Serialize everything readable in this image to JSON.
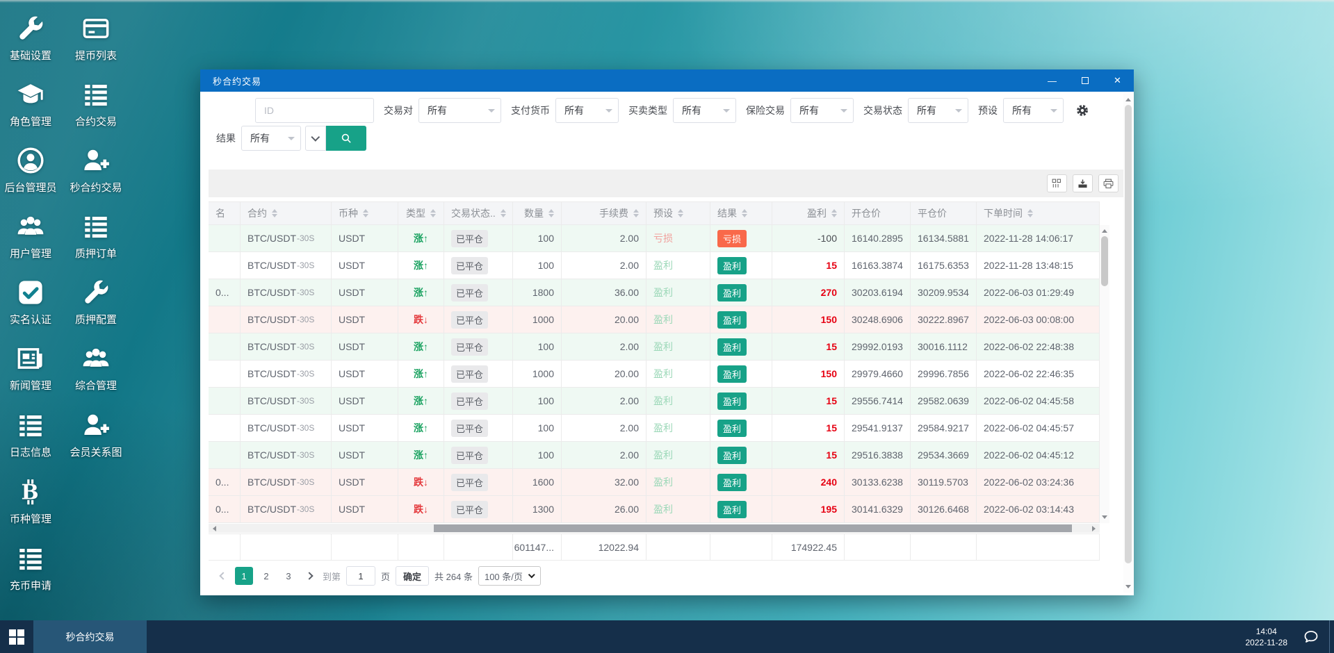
{
  "colors": {
    "titlebar_blue": "#0a6dc2",
    "accent_teal": "#17a288",
    "rise_green": "#1aa260",
    "fall_red": "#e4393c",
    "profit_red": "#e60012",
    "loss_chip_orange": "#f9694a",
    "row_green_tint": "#eff9f3",
    "row_fall_tint": "#fdf1ef",
    "taskbar_navy": "#152f4a"
  },
  "desktop": {
    "icons": [
      {
        "label": "基础设置",
        "icon": "wrench-icon"
      },
      {
        "label": "提币列表",
        "icon": "card-icon"
      },
      {
        "label": "角色管理",
        "icon": "graduation-cap-icon"
      },
      {
        "label": "合约交易",
        "icon": "list-icon"
      },
      {
        "label": "后台管理员",
        "icon": "user-circle-icon"
      },
      {
        "label": "秒合约交易",
        "icon": "user-plus-icon"
      },
      {
        "label": "用户管理",
        "icon": "users-icon"
      },
      {
        "label": "质押订单",
        "icon": "list-icon"
      },
      {
        "label": "实名认证",
        "icon": "check-square-icon"
      },
      {
        "label": "质押配置",
        "icon": "wrench-icon"
      },
      {
        "label": "新闻管理",
        "icon": "newspaper-icon"
      },
      {
        "label": "综合管理",
        "icon": "users-icon"
      },
      {
        "label": "日志信息",
        "icon": "list-icon"
      },
      {
        "label": "会员关系图",
        "icon": "user-plus-icon"
      },
      {
        "label": "币种管理",
        "icon": "bitcoin-icon"
      },
      {
        "label": "充币申请",
        "icon": "list-icon"
      }
    ]
  },
  "window": {
    "title": "秒合约交易",
    "controls": {
      "minimize": "—",
      "close": "✕"
    },
    "filters": {
      "id_placeholder": "ID",
      "selects": [
        {
          "label": "交易对",
          "value": "所有"
        },
        {
          "label": "支付货币",
          "value": "所有"
        },
        {
          "label": "买卖类型",
          "value": "所有"
        },
        {
          "label": "保险交易",
          "value": "所有"
        },
        {
          "label": "交易状态",
          "value": "所有"
        },
        {
          "label": "预设",
          "value": "所有"
        }
      ],
      "result_label": "结果",
      "result_value": "所有"
    },
    "toolbar": {
      "buttons": [
        "columns-icon",
        "export-icon",
        "printer-icon"
      ]
    },
    "table": {
      "columns": [
        {
          "key": "user",
          "label": "名",
          "sortable": false,
          "align": "left"
        },
        {
          "key": "contract",
          "label": "合约",
          "sortable": true,
          "align": "left"
        },
        {
          "key": "coin",
          "label": "币种",
          "sortable": true,
          "align": "left"
        },
        {
          "key": "type",
          "label": "类型",
          "sortable": true,
          "align": "center"
        },
        {
          "key": "status",
          "label": "交易状态..",
          "sortable": true,
          "align": "left"
        },
        {
          "key": "qty",
          "label": "数量",
          "sortable": true,
          "align": "right"
        },
        {
          "key": "fee",
          "label": "手续费",
          "sortable": true,
          "align": "right"
        },
        {
          "key": "preset",
          "label": "预设",
          "sortable": true,
          "align": "left"
        },
        {
          "key": "result",
          "label": "结果",
          "sortable": true,
          "align": "left"
        },
        {
          "key": "profit",
          "label": "盈利",
          "sortable": true,
          "align": "right"
        },
        {
          "key": "open",
          "label": "开仓价",
          "sortable": false,
          "align": "left"
        },
        {
          "key": "close",
          "label": "平仓价",
          "sortable": false,
          "align": "left"
        },
        {
          "key": "time",
          "label": "下单时间",
          "sortable": true,
          "align": "left"
        }
      ],
      "rows": [
        {
          "user": "",
          "contract": "BTC/USDT",
          "suffix": "-30S",
          "coin": "USDT",
          "type": "涨",
          "status": "已平仓",
          "qty": "100",
          "fee": "2.00",
          "preset": "亏损",
          "result": "亏损",
          "profit": "-100",
          "open": "16140.2895",
          "close": "16134.5881",
          "time": "2022-11-28 14:06:17"
        },
        {
          "user": "",
          "contract": "BTC/USDT",
          "suffix": "-30S",
          "coin": "USDT",
          "type": "涨",
          "status": "已平仓",
          "qty": "100",
          "fee": "2.00",
          "preset": "盈利",
          "result": "盈利",
          "profit": "15",
          "open": "16163.3874",
          "close": "16175.6353",
          "time": "2022-11-28 13:48:15"
        },
        {
          "user": "0...",
          "contract": "BTC/USDT",
          "suffix": "-30S",
          "coin": "USDT",
          "type": "涨",
          "status": "已平仓",
          "qty": "1800",
          "fee": "36.00",
          "preset": "盈利",
          "result": "盈利",
          "profit": "270",
          "open": "30203.6194",
          "close": "30209.9534",
          "time": "2022-06-03 01:29:49"
        },
        {
          "user": "",
          "contract": "BTC/USDT",
          "suffix": "-30S",
          "coin": "USDT",
          "type": "跌",
          "status": "已平仓",
          "qty": "1000",
          "fee": "20.00",
          "preset": "盈利",
          "result": "盈利",
          "profit": "150",
          "open": "30248.6906",
          "close": "30222.8967",
          "time": "2022-06-03 00:08:00"
        },
        {
          "user": "",
          "contract": "BTC/USDT",
          "suffix": "-30S",
          "coin": "USDT",
          "type": "涨",
          "status": "已平仓",
          "qty": "100",
          "fee": "2.00",
          "preset": "盈利",
          "result": "盈利",
          "profit": "15",
          "open": "29992.0193",
          "close": "30016.1112",
          "time": "2022-06-02 22:48:38"
        },
        {
          "user": "",
          "contract": "BTC/USDT",
          "suffix": "-30S",
          "coin": "USDT",
          "type": "涨",
          "status": "已平仓",
          "qty": "1000",
          "fee": "20.00",
          "preset": "盈利",
          "result": "盈利",
          "profit": "150",
          "open": "29979.4660",
          "close": "29996.7856",
          "time": "2022-06-02 22:46:35"
        },
        {
          "user": "",
          "contract": "BTC/USDT",
          "suffix": "-30S",
          "coin": "USDT",
          "type": "涨",
          "status": "已平仓",
          "qty": "100",
          "fee": "2.00",
          "preset": "盈利",
          "result": "盈利",
          "profit": "15",
          "open": "29556.7414",
          "close": "29582.0639",
          "time": "2022-06-02 04:45:58"
        },
        {
          "user": "",
          "contract": "BTC/USDT",
          "suffix": "-30S",
          "coin": "USDT",
          "type": "涨",
          "status": "已平仓",
          "qty": "100",
          "fee": "2.00",
          "preset": "盈利",
          "result": "盈利",
          "profit": "15",
          "open": "29541.9137",
          "close": "29584.9217",
          "time": "2022-06-02 04:45:57"
        },
        {
          "user": "",
          "contract": "BTC/USDT",
          "suffix": "-30S",
          "coin": "USDT",
          "type": "涨",
          "status": "已平仓",
          "qty": "100",
          "fee": "2.00",
          "preset": "盈利",
          "result": "盈利",
          "profit": "15",
          "open": "29516.3838",
          "close": "29534.3669",
          "time": "2022-06-02 04:45:12"
        },
        {
          "user": "0...",
          "contract": "BTC/USDT",
          "suffix": "-30S",
          "coin": "USDT",
          "type": "跌",
          "status": "已平仓",
          "qty": "1600",
          "fee": "32.00",
          "preset": "盈利",
          "result": "盈利",
          "profit": "240",
          "open": "30133.6238",
          "close": "30119.5703",
          "time": "2022-06-02 03:24:36"
        },
        {
          "user": "0...",
          "contract": "BTC/USDT",
          "suffix": "-30S",
          "coin": "USDT",
          "type": "跌",
          "status": "已平仓",
          "qty": "1300",
          "fee": "26.00",
          "preset": "盈利",
          "result": "盈利",
          "profit": "195",
          "open": "30141.6329",
          "close": "30126.6468",
          "time": "2022-06-02 03:14:43"
        }
      ],
      "summary": {
        "qty": "601147...",
        "fee": "12022.94",
        "profit": "174922.45"
      }
    },
    "pagination": {
      "pages": [
        "1",
        "2",
        "3"
      ],
      "active_page": "1",
      "goto_label": "到第",
      "goto_value": "1",
      "page_unit": "页",
      "confirm_label": "确定",
      "total_label": "共 264 条",
      "page_size": "100 条/页"
    }
  },
  "taskbar": {
    "active_app": "秒合约交易",
    "time": "14:04",
    "date": "2022-11-28"
  }
}
